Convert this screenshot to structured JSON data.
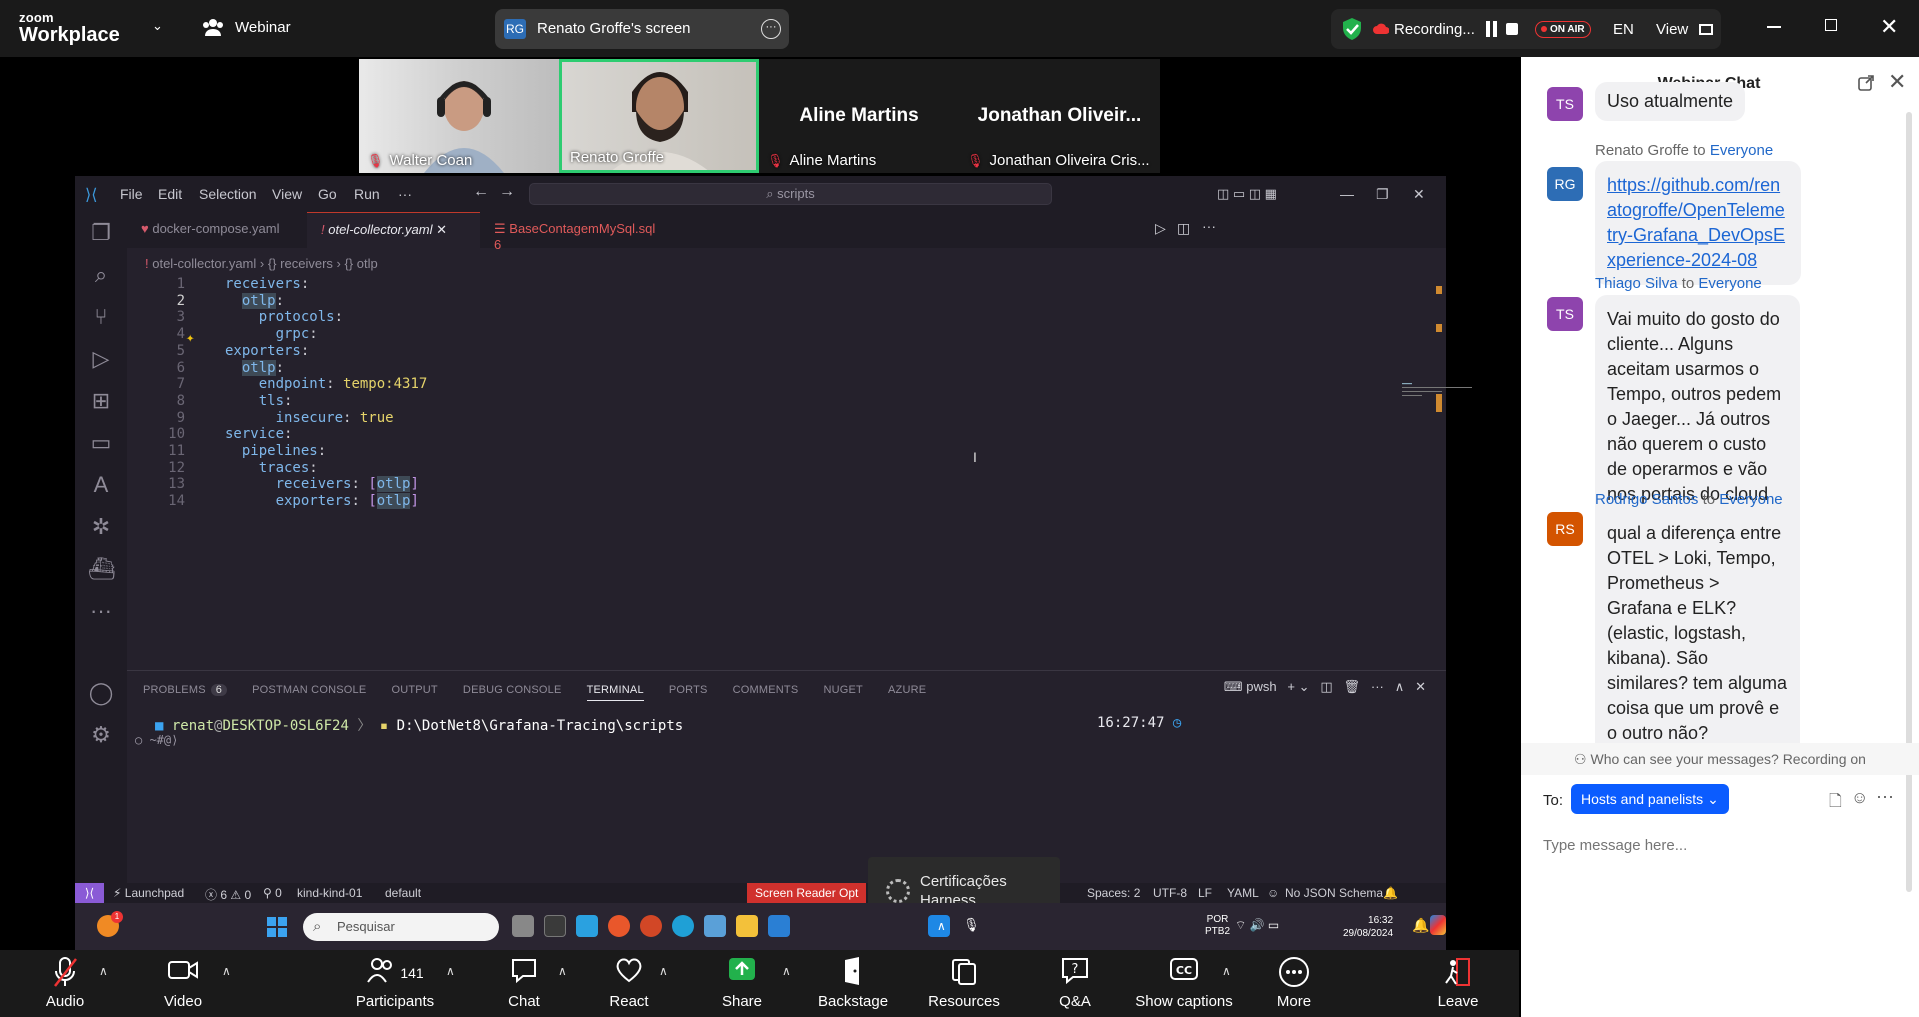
{
  "zoom": {
    "logo_line1": "zoom",
    "logo_line2": "Workplace",
    "mode_label": "Webinar",
    "share_avatar": "RG",
    "share_label": "Renato Groffe's screen",
    "recording_label": "Recording...",
    "on_air": "ON AIR",
    "language": "EN",
    "view_label": "View"
  },
  "participants_video": [
    {
      "name": "Walter Coan",
      "big": ""
    },
    {
      "name": "Renato Groffe",
      "big": ""
    },
    {
      "name": "Aline Martins",
      "big": "Aline Martins"
    },
    {
      "name": "Jonathan Oliveira Cris...",
      "big": "Jonathan  Oliveir..."
    }
  ],
  "vscode": {
    "menu": [
      "File",
      "Edit",
      "Selection",
      "View",
      "Go",
      "Run",
      "···"
    ],
    "search": "scripts",
    "tabs": [
      {
        "label": "docker-compose.yaml",
        "badge": ""
      },
      {
        "label": "otel-collector.yaml",
        "badge": ""
      },
      {
        "label": "BaseContagemMySql.sql",
        "badge": "6"
      }
    ],
    "breadcrumb": {
      "file": "otel-collector.yaml",
      "part1": "receivers",
      "part2": "otlp"
    },
    "code_lines": [
      "receivers:",
      "  otlp:",
      "    protocols:",
      "      grpc:",
      "exporters:",
      "  otlp:",
      "    endpoint: tempo:4317",
      "    tls:",
      "      insecure: true",
      "service:",
      "  pipelines:",
      "    traces:",
      "      receivers: [otlp]",
      "      exporters: [otlp]"
    ],
    "line_numbers": [
      "1",
      "2",
      "3",
      "4",
      "5",
      "6",
      "7",
      "8",
      "9",
      "10",
      "11",
      "12",
      "13",
      "14"
    ],
    "panel_tabs": [
      "PROBLEMS",
      "POSTMAN CONSOLE",
      "OUTPUT",
      "DEBUG CONSOLE",
      "TERMINAL",
      "PORTS",
      "COMMENTS",
      "NUGET",
      "AZURE"
    ],
    "problems_count": "6",
    "terminal": {
      "user": "renat",
      "host": "DESKTOP-0SL6F24",
      "path": "D:\\DotNet8\\Grafana-Tracing\\scripts",
      "time": "16:27:47",
      "prompt2": "~#@⟩",
      "shell": "pwsh"
    },
    "status": {
      "launchpad": "Launchpad",
      "errors": "6",
      "warnings": "0",
      "info": "0",
      "cluster": "kind-kind-01",
      "namespace": "default",
      "screen_reader": "Screen Reader Opt",
      "spaces": "Spaces: 2",
      "encoding": "UTF-8",
      "eol": "LF",
      "language": "YAML",
      "schema": "No JSON Schema"
    }
  },
  "toast": {
    "line1": "Certificações",
    "line2": "Harness"
  },
  "taskbar": {
    "search_placeholder": "Pesquisar",
    "lang_line1": "POR",
    "lang_line2": "PTB2",
    "time": "16:32",
    "date": "29/08/2024",
    "notif_badge": "1"
  },
  "toolbar": {
    "audio": "Audio",
    "video": "Video",
    "participants": "Participants",
    "participants_count": "141",
    "chat": "Chat",
    "react": "React",
    "share": "Share",
    "backstage": "Backstage",
    "resources": "Resources",
    "qa": "Q&A",
    "captions": "Show captions",
    "more": "More",
    "leave": "Leave"
  },
  "chat": {
    "title": "Webinar Chat",
    "messages": [
      {
        "avatar": "TS",
        "color": "#8e44ad",
        "sender": "",
        "to": "",
        "text": "Uso atualmente"
      },
      {
        "avatar": "RG",
        "color": "#2d6db5",
        "sender": "Renato Groffe",
        "to": "Everyone",
        "text": "https://github.com/renatogroffe/OpenTelemetry-Grafana_DevOpsExperience-2024-08"
      },
      {
        "avatar": "TS",
        "color": "#8e44ad",
        "sender": "Thiago Silva",
        "to": "Everyone",
        "text": "Vai muito do gosto do cliente... Alguns aceitam usarmos o Tempo, outros pedem o Jaeger... Já outros não querem o custo de operarmos e vão nos portais do cloud provider..."
      },
      {
        "avatar": "RS",
        "color": "#d35400",
        "sender": "Rodrigo Santos",
        "to": "Everyone",
        "text": "qual a diferença entre OTEL > Loki, Tempo, Prometheus > Grafana e ELK? (elastic, logstash, kibana). São similares? tem alguma coisa que um provê e o outro não?"
      }
    ],
    "to_word": "to",
    "privacy": "Who can see your messages? Recording on",
    "to_label": "To:",
    "recipient": "Hosts and panelists",
    "placeholder": "Type message here..."
  }
}
